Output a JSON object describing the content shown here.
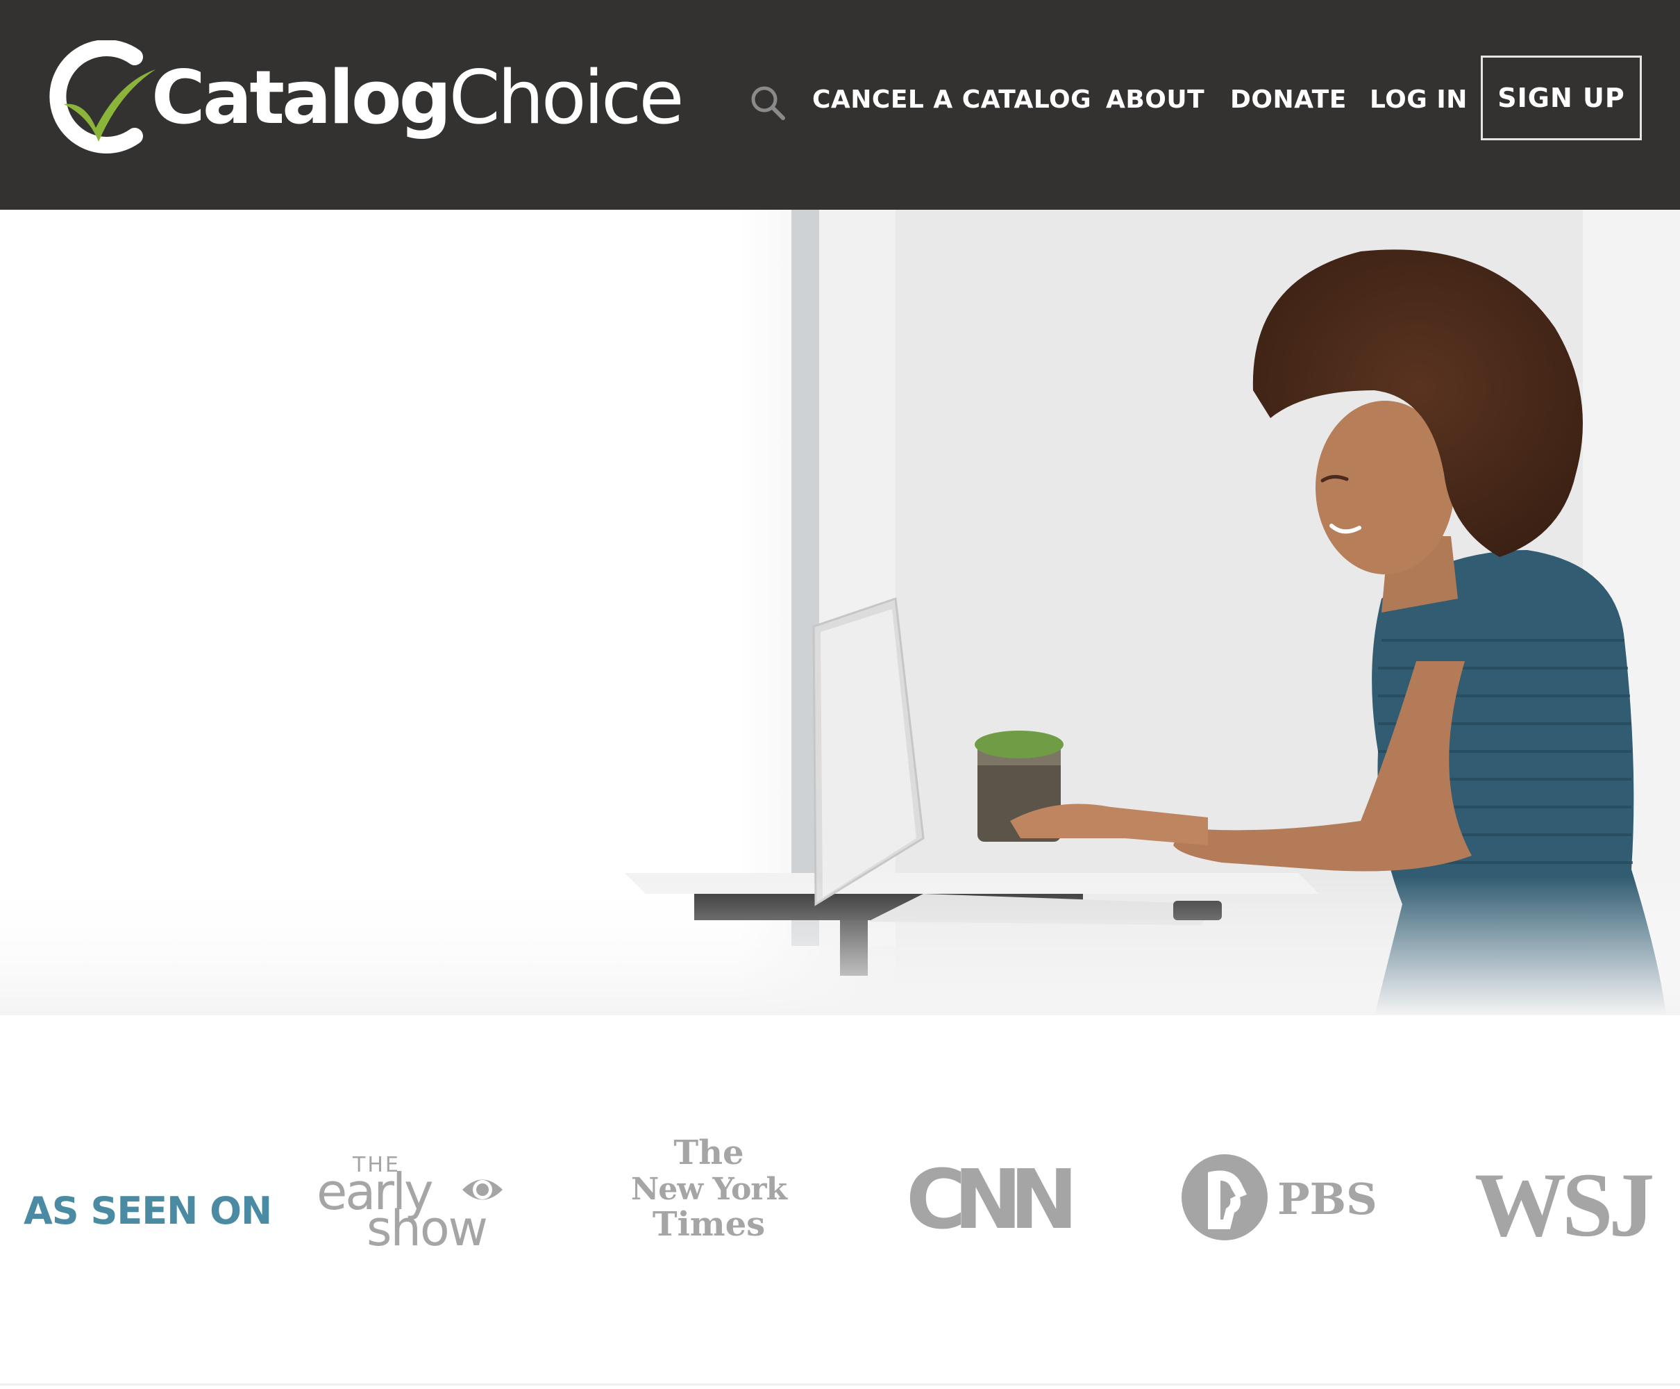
{
  "header": {
    "logo": {
      "bold": "Catalog",
      "light": "Choice"
    },
    "search_icon": "search-icon",
    "nav": [
      {
        "label": "CANCEL A CATALOG"
      },
      {
        "label": "ABOUT"
      },
      {
        "label": "DONATE"
      },
      {
        "label": "LOG IN"
      }
    ],
    "signup_label": "SIGN UP"
  },
  "press": {
    "label": "AS SEEN ON",
    "logos": {
      "early_show": {
        "the": "THE",
        "early": "early",
        "show": "show"
      },
      "nyt": {
        "line1": "The",
        "line2": "New York",
        "line3": "Times"
      },
      "cnn": "CNN",
      "pbs": "PBS",
      "wsj": "WSJ"
    }
  },
  "colors": {
    "header_bg": "#343231",
    "accent_green": "#8ab43a",
    "press_label": "#4a8ba3",
    "press_logo_gray": "#a5a5a5"
  }
}
